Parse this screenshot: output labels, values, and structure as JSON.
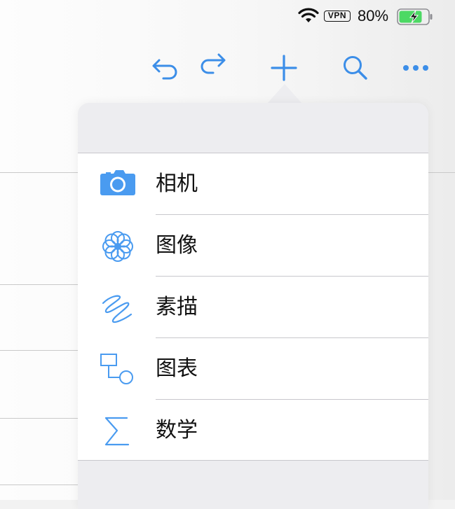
{
  "status_bar": {
    "wifi_icon": "wifi-icon",
    "vpn_label": "VPN",
    "battery_percent": "80%",
    "battery_level": 0.8,
    "battery_color": "#4cd964"
  },
  "toolbar": {
    "accent_color": "#3c8ee8",
    "buttons": [
      {
        "icon": "undo-icon"
      },
      {
        "icon": "redo-icon"
      },
      {
        "icon": "plus-icon"
      },
      {
        "icon": "search-icon"
      },
      {
        "icon": "more-icon"
      }
    ]
  },
  "insert_menu": {
    "items": [
      {
        "label": "相机",
        "icon": "camera-icon"
      },
      {
        "label": "图像",
        "icon": "photos-icon"
      },
      {
        "label": "素描",
        "icon": "sketch-icon"
      },
      {
        "label": "图表",
        "icon": "diagram-icon"
      },
      {
        "label": "数学",
        "icon": "sigma-icon"
      }
    ]
  }
}
